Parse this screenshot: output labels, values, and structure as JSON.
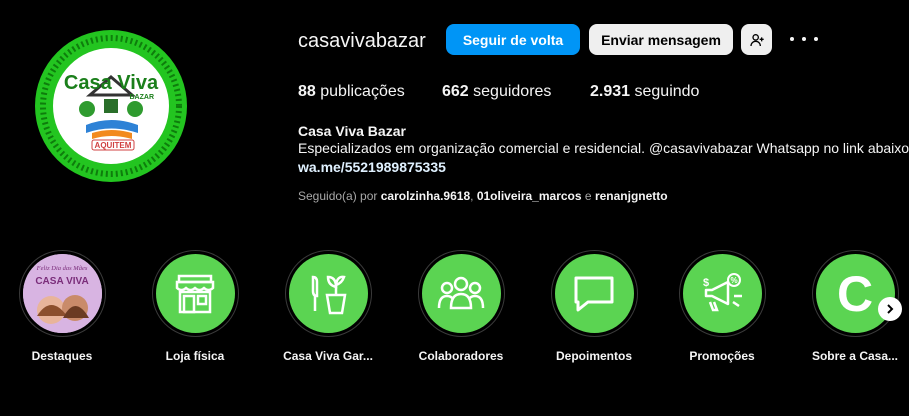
{
  "profile": {
    "username": "casavivabazar",
    "display_name": "Casa Viva Bazar",
    "bio": "Especializados em organização comercial e residencial. @casavivabazar Whatsapp no link abaixo.",
    "link": "wa.me/5521989875335",
    "avatar_logo": {
      "line1": "Casa Viva",
      "line2": "BAZAR",
      "line3": "AQUITEM"
    }
  },
  "actions": {
    "follow_back": "Seguir de volta",
    "send_message": "Enviar mensagem",
    "add_user_icon": "person-plus-icon",
    "more_icon": "more-options-icon"
  },
  "stats": {
    "posts_count": "88",
    "posts_label": "publicações",
    "followers_count": "662",
    "followers_label": "seguidores",
    "following_count": "2.931",
    "following_label": "seguindo"
  },
  "followed_by": {
    "prefix": "Seguido(a) por",
    "user1": "carolzinha.9618",
    "sep1": ",",
    "user2": "01oliveira_marcos",
    "conj": "e",
    "user3": "renanjgnetto"
  },
  "highlights": [
    {
      "label": "Destaques",
      "icon": "photo-thumbnail",
      "thumb_text1": "Feliz Dia das Mães",
      "thumb_text2": "CASA VIVA"
    },
    {
      "label": "Loja física",
      "icon": "storefront-icon"
    },
    {
      "label": "Casa Viva Gar...",
      "icon": "gardening-icon"
    },
    {
      "label": "Colaboradores",
      "icon": "group-icon"
    },
    {
      "label": "Depoimentos",
      "icon": "chat-bubble-icon"
    },
    {
      "label": "Promoções",
      "icon": "megaphone-icon"
    },
    {
      "label": "Sobre a Casa...",
      "icon": "letter-c-icon",
      "letter": "C"
    }
  ],
  "colors": {
    "accent_blue": "#0095f6",
    "highlight_green": "#5bd452",
    "avatar_green": "#22c31f"
  }
}
